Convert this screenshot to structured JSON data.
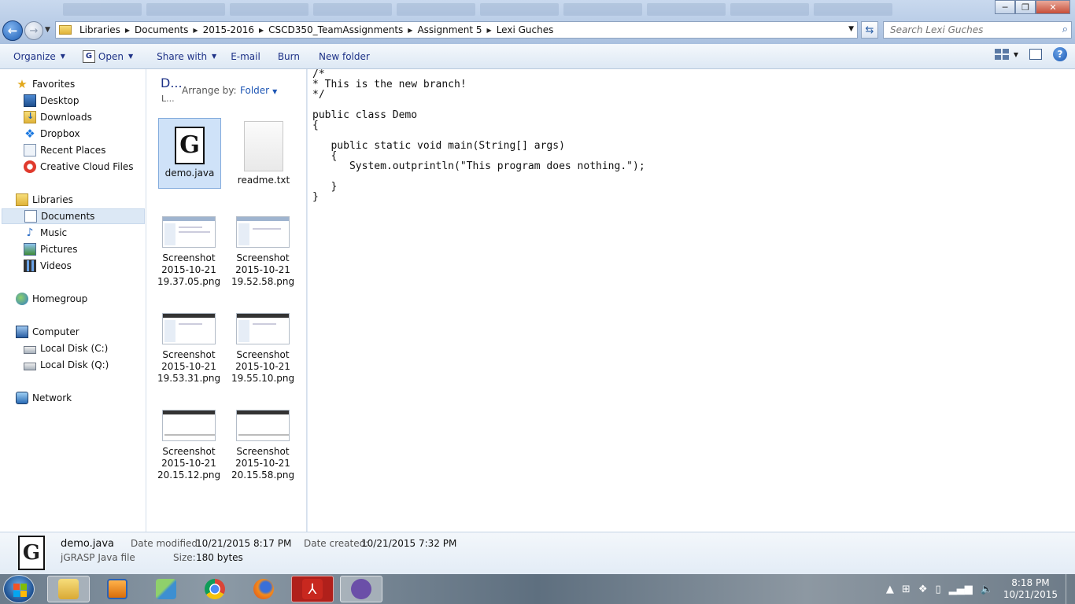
{
  "window": {
    "minimize": "─",
    "maximize": "❐",
    "close": "✕"
  },
  "nav": {
    "back": "←",
    "forward": "→",
    "recent": "▼"
  },
  "address": {
    "crumbs": [
      "Libraries",
      "Documents",
      "2015-2016",
      "CSCD350_TeamAssignments",
      "Assignment 5",
      "Lexi Guches"
    ],
    "dropdown": "▼",
    "refresh": "⇆"
  },
  "search": {
    "placeholder": "Search Lexi Guches",
    "icon": "search-icon"
  },
  "toolbar": {
    "organize": "Organize",
    "open": "Open",
    "share_with": "Share with",
    "email": "E-mail",
    "burn": "Burn",
    "new_folder": "New folder",
    "help": "?"
  },
  "sidebar": {
    "favorites": "Favorites",
    "desktop": "Desktop",
    "downloads": "Downloads",
    "dropbox": "Dropbox",
    "recent_places": "Recent Places",
    "creative_cloud": "Creative Cloud Files",
    "libraries": "Libraries",
    "documents": "Documents",
    "music": "Music",
    "pictures": "Pictures",
    "videos": "Videos",
    "homegroup": "Homegroup",
    "computer": "Computer",
    "local_c": "Local Disk (C:)",
    "local_q": "Local Disk (Q:)",
    "network": "Network"
  },
  "library_header": {
    "title": "D...",
    "subtitle": "L...",
    "arrange_label": "Arrange by:",
    "arrange_value": "Folder"
  },
  "files": [
    {
      "name": "demo.java",
      "line2": "",
      "line3": ""
    },
    {
      "name": "readme.txt",
      "line2": "",
      "line3": ""
    },
    {
      "name": "Screenshot",
      "line2": "2015-10-21",
      "line3": "19.37.05.png"
    },
    {
      "name": "Screenshot",
      "line2": "2015-10-21",
      "line3": "19.52.58.png"
    },
    {
      "name": "Screenshot",
      "line2": "2015-10-21",
      "line3": "19.53.31.png"
    },
    {
      "name": "Screenshot",
      "line2": "2015-10-21",
      "line3": "19.55.10.png"
    },
    {
      "name": "Screenshot",
      "line2": "2015-10-21",
      "line3": "20.15.12.png"
    },
    {
      "name": "Screenshot",
      "line2": "2015-10-21",
      "line3": "20.15.58.png"
    }
  ],
  "preview": {
    "code": "/*\n* This is the new branch!\n*/\n\npublic class Demo\n{\n\n   public static void main(String[] args)\n   {\n      System.outprintln(\"This program does nothing.\");\n\n   }\n}"
  },
  "details": {
    "icon_letter": "G",
    "file_name": "demo.java",
    "file_type": "jGRASP Java file",
    "modified_label": "Date modified:",
    "modified_value": "10/21/2015 8:17 PM",
    "created_label": "Date created:",
    "created_value": "10/21/2015 7:32 PM",
    "size_label": "Size:",
    "size_value": "180 bytes"
  },
  "taskbar": {
    "apps": [
      "explorer-icon",
      "media-icon",
      "network-app-icon",
      "chrome-icon",
      "firefox-icon",
      "acrobat-icon",
      "github-icon"
    ],
    "time": "8:18 PM",
    "date": "10/21/2015"
  },
  "colors": {
    "accent": "#1e3287",
    "selection": "#cfe2f8",
    "link": "#1e56b4"
  }
}
